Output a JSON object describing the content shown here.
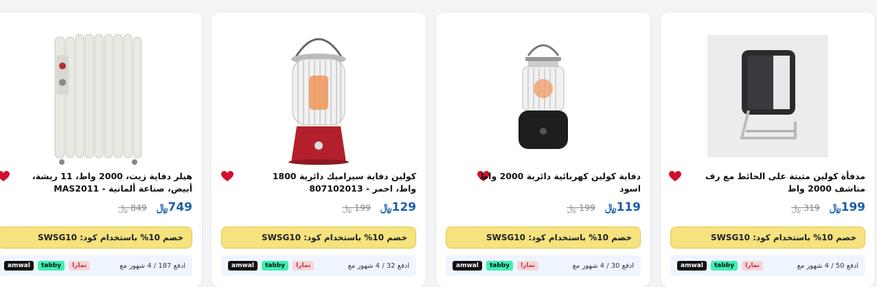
{
  "colors": {
    "price": "#1a5fa8",
    "coupon_bg": "#f6e27e",
    "heart": "#d0102e"
  },
  "currency_symbol": "﷼",
  "products": [
    {
      "title": "مدفأة كولين مثبتة على الحائط مع رف مناشف 2000 واط",
      "price": "199",
      "old_price": "319",
      "coupon": "خصم 10% باستخدام كود: SWSG10",
      "installment": "ادفع 50 / 4 شهور مع",
      "icon": "wall-heater-image"
    },
    {
      "title": "دفاية كولين كهربائية دائرية 2000 واط اسود",
      "price": "119",
      "old_price": "199",
      "coupon": "خصم 10% باستخدام كود: SWSG10",
      "installment": "ادفع 30 / 4 شهور مع",
      "icon": "round-heater-image"
    },
    {
      "title": "كولين دفاية سيراميك دائرية 1800 واط، احمر - 807102013",
      "price": "129",
      "old_price": "199",
      "coupon": "خصم 10% باستخدام كود: SWSG10",
      "installment": "ادفع 32 / 4 شهور مع",
      "icon": "ceramic-heater-image"
    },
    {
      "title": "هيلر دفاية زيت، 2000 واط، 11 ريشة، أبيض، صناعة ألمانية - MAS2011",
      "price": "749",
      "old_price": "849",
      "coupon": "خصم 10% باستخدام كود: SWSG10",
      "installment": "ادفع 187 / 4 شهور مع",
      "icon": "oil-heater-image"
    }
  ],
  "payment_badges": {
    "amwal": "amwal",
    "tabby": "tabby",
    "tamara": "تمارا"
  }
}
